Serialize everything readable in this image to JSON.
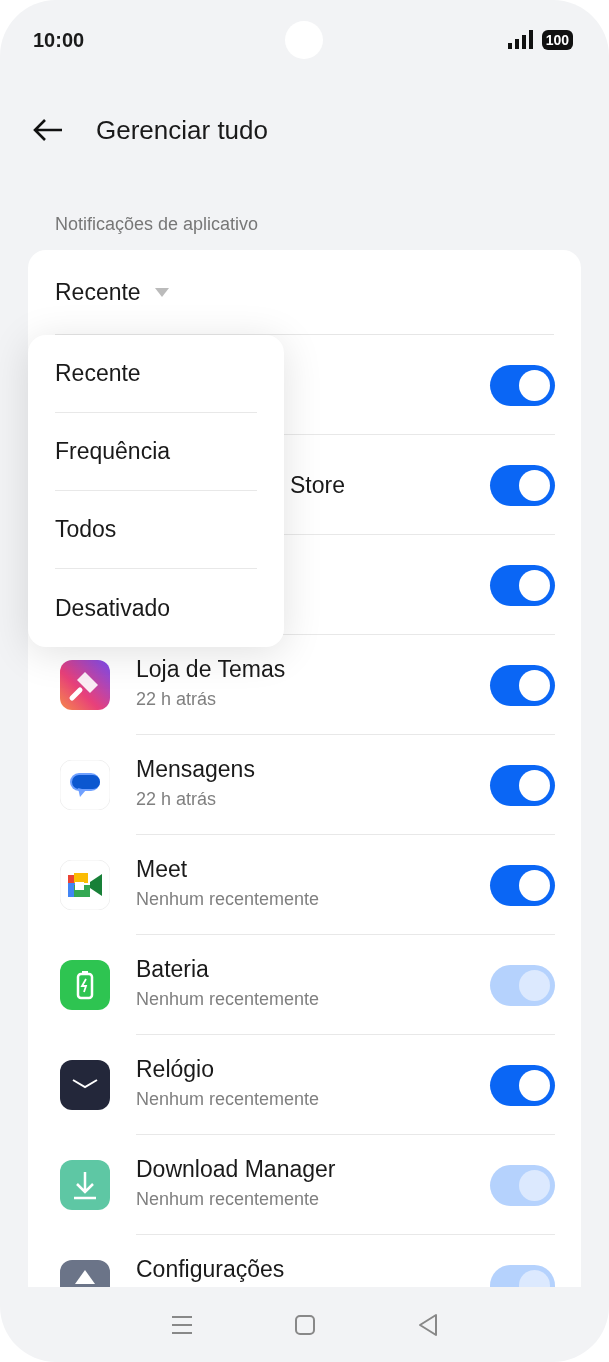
{
  "status_bar": {
    "time": "10:00",
    "battery": "100"
  },
  "header": {
    "title": "Gerenciar tudo"
  },
  "section_label": "Notificações de aplicativo",
  "sort": {
    "label": "Recente"
  },
  "sort_menu": {
    "options": [
      "Recente",
      "Frequência",
      "Todos",
      "Desativado"
    ]
  },
  "apps": [
    {
      "kind": "covered",
      "on": true,
      "disabled": false
    },
    {
      "kind": "covered",
      "name": "Store",
      "on": true,
      "disabled": false
    },
    {
      "kind": "covered",
      "on": true,
      "disabled": false
    },
    {
      "kind": "app",
      "name": "Loja de Temas",
      "subtitle": "22 h atrás",
      "on": true,
      "disabled": false
    },
    {
      "kind": "app",
      "name": "Mensagens",
      "subtitle": "22 h atrás",
      "on": true,
      "disabled": false
    },
    {
      "kind": "app",
      "name": "Meet",
      "subtitle": "Nenhum recentemente",
      "on": true,
      "disabled": false
    },
    {
      "kind": "app",
      "name": "Bateria",
      "subtitle": "Nenhum recentemente",
      "on": true,
      "disabled": true
    },
    {
      "kind": "app",
      "name": "Relógio",
      "subtitle": "Nenhum recentemente",
      "on": true,
      "disabled": false
    },
    {
      "kind": "app",
      "name": "Download Manager",
      "subtitle": "Nenhum recentemente",
      "on": true,
      "disabled": true
    },
    {
      "kind": "app",
      "name": "Configurações",
      "on": true,
      "disabled": true
    }
  ]
}
